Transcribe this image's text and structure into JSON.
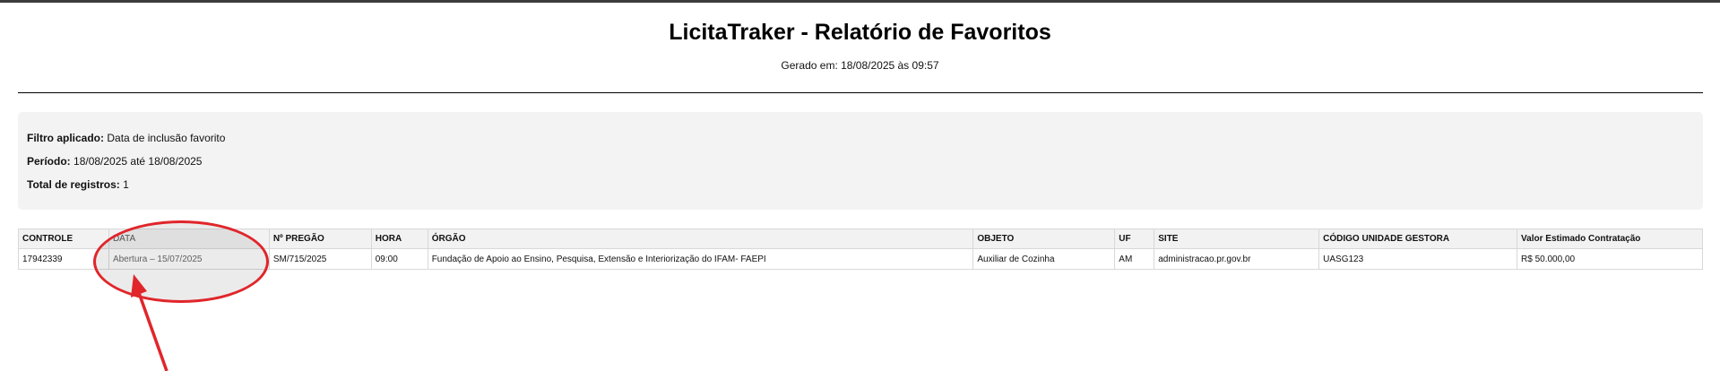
{
  "report": {
    "title": "LicitaTraker - Relatório de Favoritos",
    "generated": "Gerado em: 18/08/2025 às 09:57"
  },
  "filter": {
    "filter_label": "Filtro aplicado:",
    "filter_value": "Data de inclusão favorito",
    "period_label": "Período:",
    "period_value": "18/08/2025 até 18/08/2025",
    "total_label": "Total de registros:",
    "total_value": "1"
  },
  "table": {
    "headers": [
      "CONTROLE",
      "DATA",
      "Nº PREGÃO",
      "HORA",
      "ÓRGÃO",
      "OBJETO",
      "UF",
      "SITE",
      "CÓDIGO UNIDADE GESTORA",
      "Valor Estimado Contratação"
    ],
    "rows": [
      [
        "17942339",
        "Abertura – 15/07/2025",
        "SM/715/2025",
        "09:00",
        "Fundação de Apoio ao Ensino, Pesquisa, Extensão e Interiorização do IFAM- FAEPI",
        "Auxiliar de Cozinha",
        "AM",
        "administracao.pr.gov.br",
        "UASG123",
        "R$ 50.000,00"
      ]
    ]
  },
  "annotation": {
    "color": "#e0262b"
  }
}
